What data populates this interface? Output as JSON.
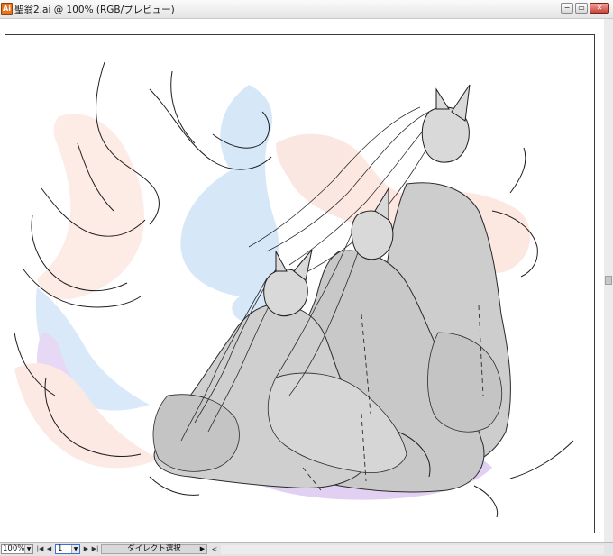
{
  "window": {
    "title": "聖翁2.ai @ 100% (RGB/プレビュー)",
    "doc_icon": "Ai",
    "controls": {
      "minimize": "−",
      "restore": "▭",
      "close": "✕"
    }
  },
  "statusbar": {
    "zoom": "100%",
    "page": "1",
    "tool_status": "ダイレクト選択",
    "first_page": "|◀",
    "prev_page": "◀",
    "next_page": "▶",
    "last_page": "▶|",
    "status_arrow": "▶",
    "scroll_left": "<"
  },
  "canvas": {
    "image": "Line-art illustration of three long-haired fox-eared figures in robes seated together, with colored flame-like tails"
  },
  "colors": {
    "title_bar": "#e4e4e4",
    "robe_fill": "#cdcdcd",
    "tail_blue": "#cfe3f7",
    "tail_pink": "#fbe3dc",
    "tail_purple": "#dcc8f0",
    "line": "#1e1e1e"
  }
}
